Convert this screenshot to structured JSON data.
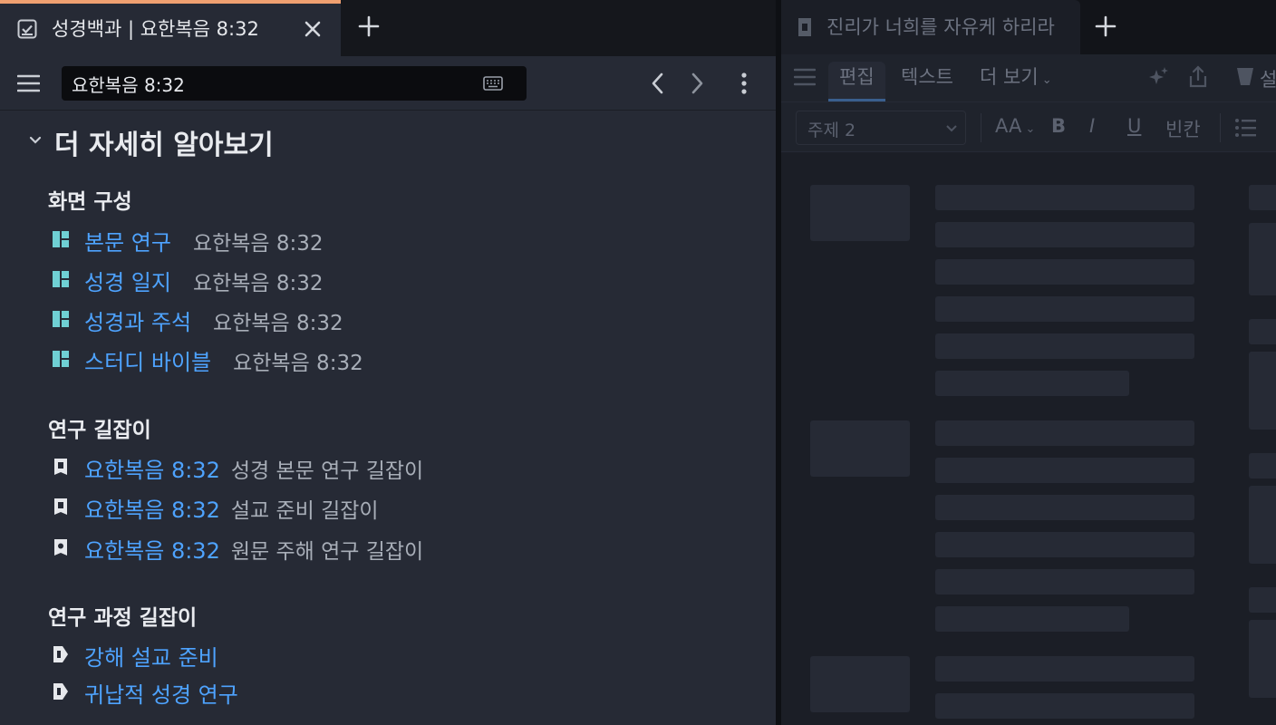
{
  "left_tab": {
    "title": "성경백과 | 요한복음 8:32",
    "icon": "checkbox-note-icon",
    "accent": "#f0a070"
  },
  "address": {
    "value": "요한복음 8:32"
  },
  "section": {
    "title": "더 자세히 알아보기"
  },
  "groups": [
    {
      "title": "화면 구성",
      "rows": [
        {
          "link": "본문 연구",
          "desc": "요한복음 8:32",
          "icon": "layout-icon"
        },
        {
          "link": "성경 일지",
          "desc": "요한복음 8:32",
          "icon": "layout-icon"
        },
        {
          "link": "성경과 주석",
          "desc": "요한복음 8:32",
          "icon": "layout-icon"
        },
        {
          "link": "스터디 바이블",
          "desc": "요한복음 8:32",
          "icon": "layout-icon"
        }
      ]
    },
    {
      "title": "연구 길잡이",
      "rows": [
        {
          "link": "요한복음 8:32",
          "desc": "성경 본문 연구 길잡이",
          "icon": "guide-icon"
        },
        {
          "link": "요한복음 8:32",
          "desc": "설교 준비 길잡이",
          "icon": "guide-icon"
        },
        {
          "link": "요한복음 8:32",
          "desc": "원문 주해 연구 길잡이",
          "icon": "guide-original-icon"
        }
      ]
    },
    {
      "title": "연구 과정 길잡이",
      "rows": [
        {
          "link": "강해 설교 준비",
          "desc": "",
          "icon": "workflow-icon"
        },
        {
          "link": "귀납적 성경 연구",
          "desc": "",
          "icon": "workflow-icon"
        }
      ]
    }
  ],
  "right_tab": {
    "title": "진리가 너희를 자유케 하리라",
    "icon": "document-icon"
  },
  "right_toolbar": {
    "tabs": [
      "편집",
      "텍스트",
      "더 보기"
    ],
    "active_tab": "편집",
    "style_select": "주제 2",
    "format": {
      "font_size": "AA",
      "bold": "B",
      "italic": "I",
      "underline": "U",
      "blank": "빈칸"
    },
    "extra": "설"
  },
  "colors": {
    "link": "#4ea3ff",
    "panel": "#262a35",
    "text": "#e9ebef",
    "muted": "#a8aeb8"
  }
}
